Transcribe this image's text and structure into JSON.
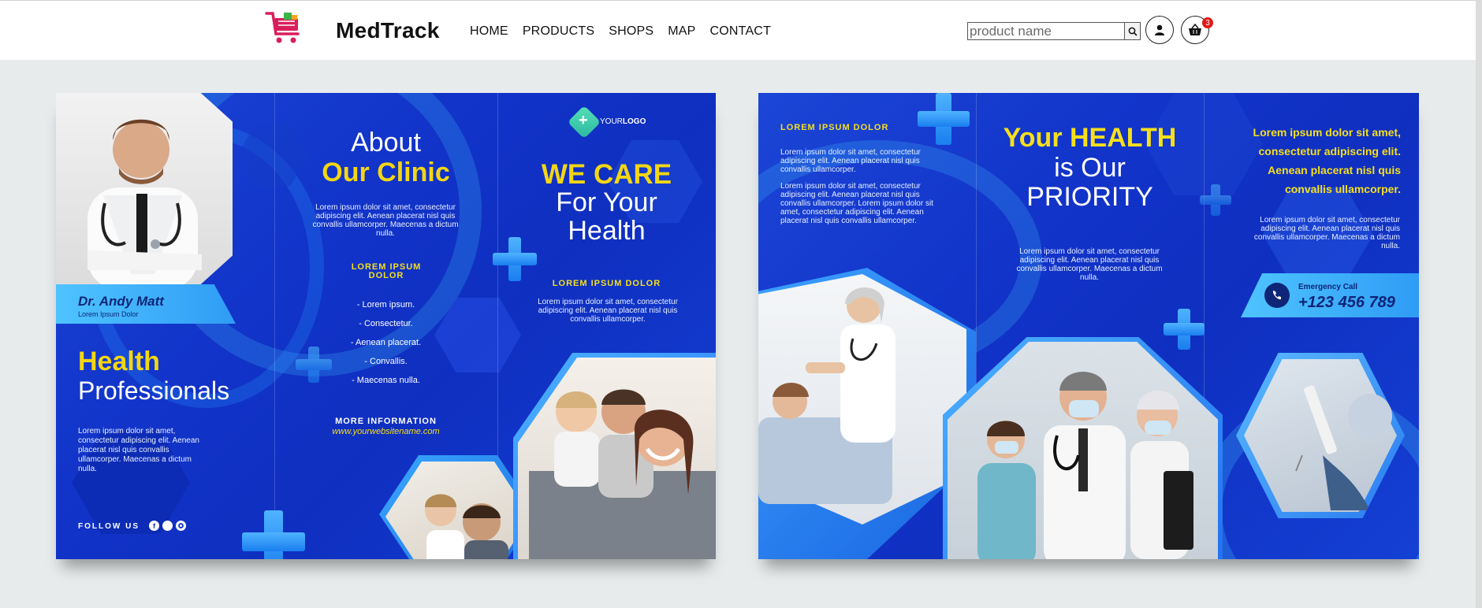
{
  "header": {
    "brand": "MedTrack",
    "nav": [
      "HOME",
      "PRODUCTS",
      "SHOPS",
      "MAP",
      "CONTACT"
    ],
    "search_placeholder": "product name",
    "cart_count": "3"
  },
  "brochure_left": {
    "doctor_name": "Dr. Andy Matt",
    "doctor_sub": "Lorem Ipsum Dolor",
    "health_title": "Health",
    "professionals_title": "Professionals",
    "left_body": "Lorem ipsum dolor sit amet, consectetur adipiscing elit. Aenean placerat nisl quis convallis ullamcorper. Maecenas a dictum nulla.",
    "follow_us": "FOLLOW US",
    "about_line1": "About",
    "about_line2": "Our Clinic",
    "about_body": "Lorem ipsum dolor sit amet, consectetur adipiscing elit. Aenean placerat nisl quis convallis ullamcorper. Maecenas a dictum nulla.",
    "lorem_heading": "LOREM IPSUM DOLOR",
    "list": [
      "- Lorem ipsum.",
      "- Consectetur.",
      "- Aenean placerat.",
      "- Convallis.",
      "- Maecenas nulla."
    ],
    "more_info": "MORE INFORMATION",
    "website": "www.yourwebsitename.com",
    "logo_text_a": "YOUR",
    "logo_text_b": "LOGO",
    "we_care": "WE CARE",
    "for_your": "For Your",
    "health": "Health",
    "right_heading": "LOREM IPSUM DOLOR",
    "right_body": "Lorem ipsum dolor sit amet, consectetur adipiscing elit. Aenean placerat nisl quis convallis ullamcorper."
  },
  "brochure_right": {
    "heading": "LOREM IPSUM DOLOR",
    "body1": "Lorem ipsum dolor sit amet, consectetur adipiscing elit. Aenean placerat nisl quis convallis ullamcorper.",
    "body2": "Lorem ipsum dolor sit amet, consectetur adipiscing elit. Aenean placerat nisl quis convallis ullamcorper. Lorem ipsum dolor sit amet, consectetur adipiscing elit. Aenean placerat nisl quis convallis ullamcorper.",
    "your_health": "Your HEALTH",
    "is_our": "is Our",
    "priority": "PRIORITY",
    "mid_body": "Lorem ipsum dolor sit amet, consectetur adipiscing elit. Aenean placerat nisl quis convallis ullamcorper. Maecenas a dictum nulla.",
    "yellow_para": "Lorem ipsum dolor sit amet, consectetur adipiscing elit. Aenean placerat nisl quis convallis ullamcorper.",
    "right_body": "Lorem ipsum dolor sit amet, consectetur adipiscing elit. Aenean placerat nisl quis convallis ullamcorper. Maecenas a dictum nulla.",
    "emergency_label": "Emergency Call",
    "phone": "+123 456 789"
  },
  "colors": {
    "brand_blue": "#1234c9",
    "accent_yellow": "#f3d614",
    "cart_badge": "#e01919"
  }
}
